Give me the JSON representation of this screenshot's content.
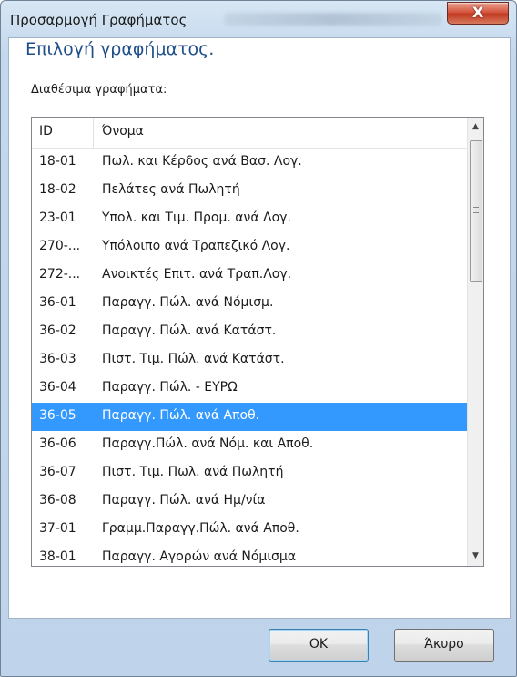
{
  "window": {
    "title": "Προσαρμογή Γραφήματος",
    "close_symbol": "X"
  },
  "dialog": {
    "heading": "Επιλογή γραφήματος.",
    "list_label": "Διαθέσιμα γραφήματα:"
  },
  "list": {
    "columns": {
      "id": "ID",
      "name": "Όνομα"
    },
    "rows": [
      {
        "id": "18-01",
        "name": "Πωλ. και Κέρδος ανά Βασ. Λογ."
      },
      {
        "id": "18-02",
        "name": "Πελάτες ανά Πωλητή"
      },
      {
        "id": "23-01",
        "name": "Υπολ. και Τιμ. Προμ. ανά Λογ."
      },
      {
        "id": "270-...",
        "name": "Υπόλοιπο ανά Τραπεζικό Λογ."
      },
      {
        "id": "272-...",
        "name": "Ανοικτές Επιτ. ανά Τραπ.Λογ."
      },
      {
        "id": "36-01",
        "name": "Παραγγ. Πώλ. ανά Νόμισμ."
      },
      {
        "id": "36-02",
        "name": "Παραγγ. Πώλ. ανά Κατάστ."
      },
      {
        "id": "36-03",
        "name": "Πιστ. Τιμ. Πώλ. ανά Κατάστ."
      },
      {
        "id": "36-04",
        "name": "Παραγγ. Πώλ. - ΕΥΡΩ"
      },
      {
        "id": "36-05",
        "name": "Παραγγ. Πώλ. ανά Αποθ."
      },
      {
        "id": "36-06",
        "name": "Παραγγ.Πώλ. ανά Νόμ. και Αποθ."
      },
      {
        "id": "36-07",
        "name": "Πιστ. Τιμ. Πωλ. ανά Πωλητή"
      },
      {
        "id": "36-08",
        "name": "Παραγγ. Πώλ. ανά Ημ/νία"
      },
      {
        "id": "37-01",
        "name": "Γραμμ.Παραγγ.Πώλ. ανά Αποθ."
      },
      {
        "id": "38-01",
        "name": "Παραγγ. Αγορών ανά Νόμισμα"
      }
    ],
    "selected_index": 9
  },
  "buttons": {
    "ok": "OK",
    "cancel": "Άκυρο"
  }
}
